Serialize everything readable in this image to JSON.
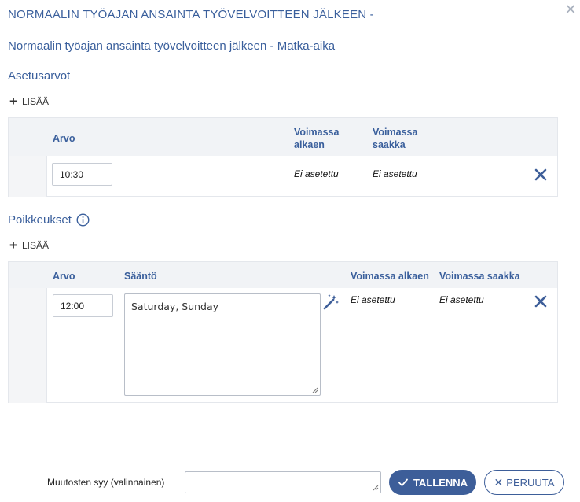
{
  "dialog": {
    "title": "NORMAALIN TYÖAJAN ANSAINTA TYÖVELVOITTEEN JÄLKEEN -",
    "subtitle": "Normaalin työajan ansainta työvelvoitteen jälkeen - Matka-aika"
  },
  "settings": {
    "heading": "Asetusarvot",
    "add_label": "LISÄÄ",
    "columns": {
      "value": "Arvo",
      "valid_from": "Voimassa alkaen",
      "valid_to": "Voimassa saakka"
    },
    "rows": [
      {
        "value": "10:30",
        "valid_from": "Ei asetettu",
        "valid_to": "Ei asetettu"
      }
    ]
  },
  "exceptions": {
    "heading": "Poikkeukset",
    "add_label": "LISÄÄ",
    "columns": {
      "value": "Arvo",
      "rule": "Sääntö",
      "valid_from": "Voimassa alkaen",
      "valid_to": "Voimassa saakka"
    },
    "rows": [
      {
        "value": "12:00",
        "rule": "Saturday, Sunday",
        "valid_from": "Ei asetettu",
        "valid_to": "Ei asetettu"
      }
    ]
  },
  "footer": {
    "reason_label": "Muutosten syy (valinnainen)",
    "reason_value": "",
    "save_label": "TALLENNA",
    "cancel_label": "PERUUTA"
  },
  "colors": {
    "accent": "#3d5e99",
    "heading": "#3a5f9c",
    "header_bg": "#f1f3f6"
  },
  "icons": {
    "close": "close-icon",
    "add": "plus-icon",
    "delete": "x-delete-icon",
    "info": "info-icon",
    "magic": "magic-wand-icon",
    "check": "check-icon"
  }
}
